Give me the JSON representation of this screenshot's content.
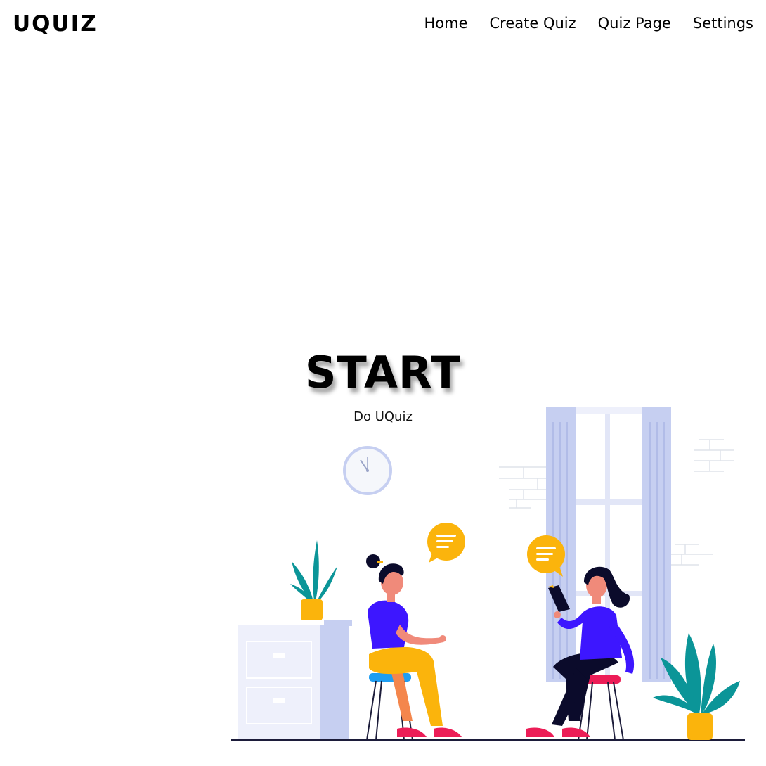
{
  "navbar": {
    "brand": "UQUIZ",
    "links": [
      {
        "label": "Home"
      },
      {
        "label": "Create Quiz"
      },
      {
        "label": "Quiz Page"
      },
      {
        "label": "Settings"
      }
    ]
  },
  "hero": {
    "title": "START",
    "subtitle": "Do UQuiz"
  },
  "illustration": {
    "icons": [
      "wall-clock-icon",
      "plant-icon",
      "speech-bubble-icon",
      "window-icon",
      "cabinet-icon",
      "chair-icon",
      "book-icon"
    ],
    "colors": {
      "purple": "#3d16ff",
      "yellow": "#fbb40c",
      "teal": "#0b9598",
      "lavender": "#c6cff1",
      "pale": "#eef0fb",
      "red": "#ec1d57",
      "navy": "#0b0b2b"
    }
  }
}
